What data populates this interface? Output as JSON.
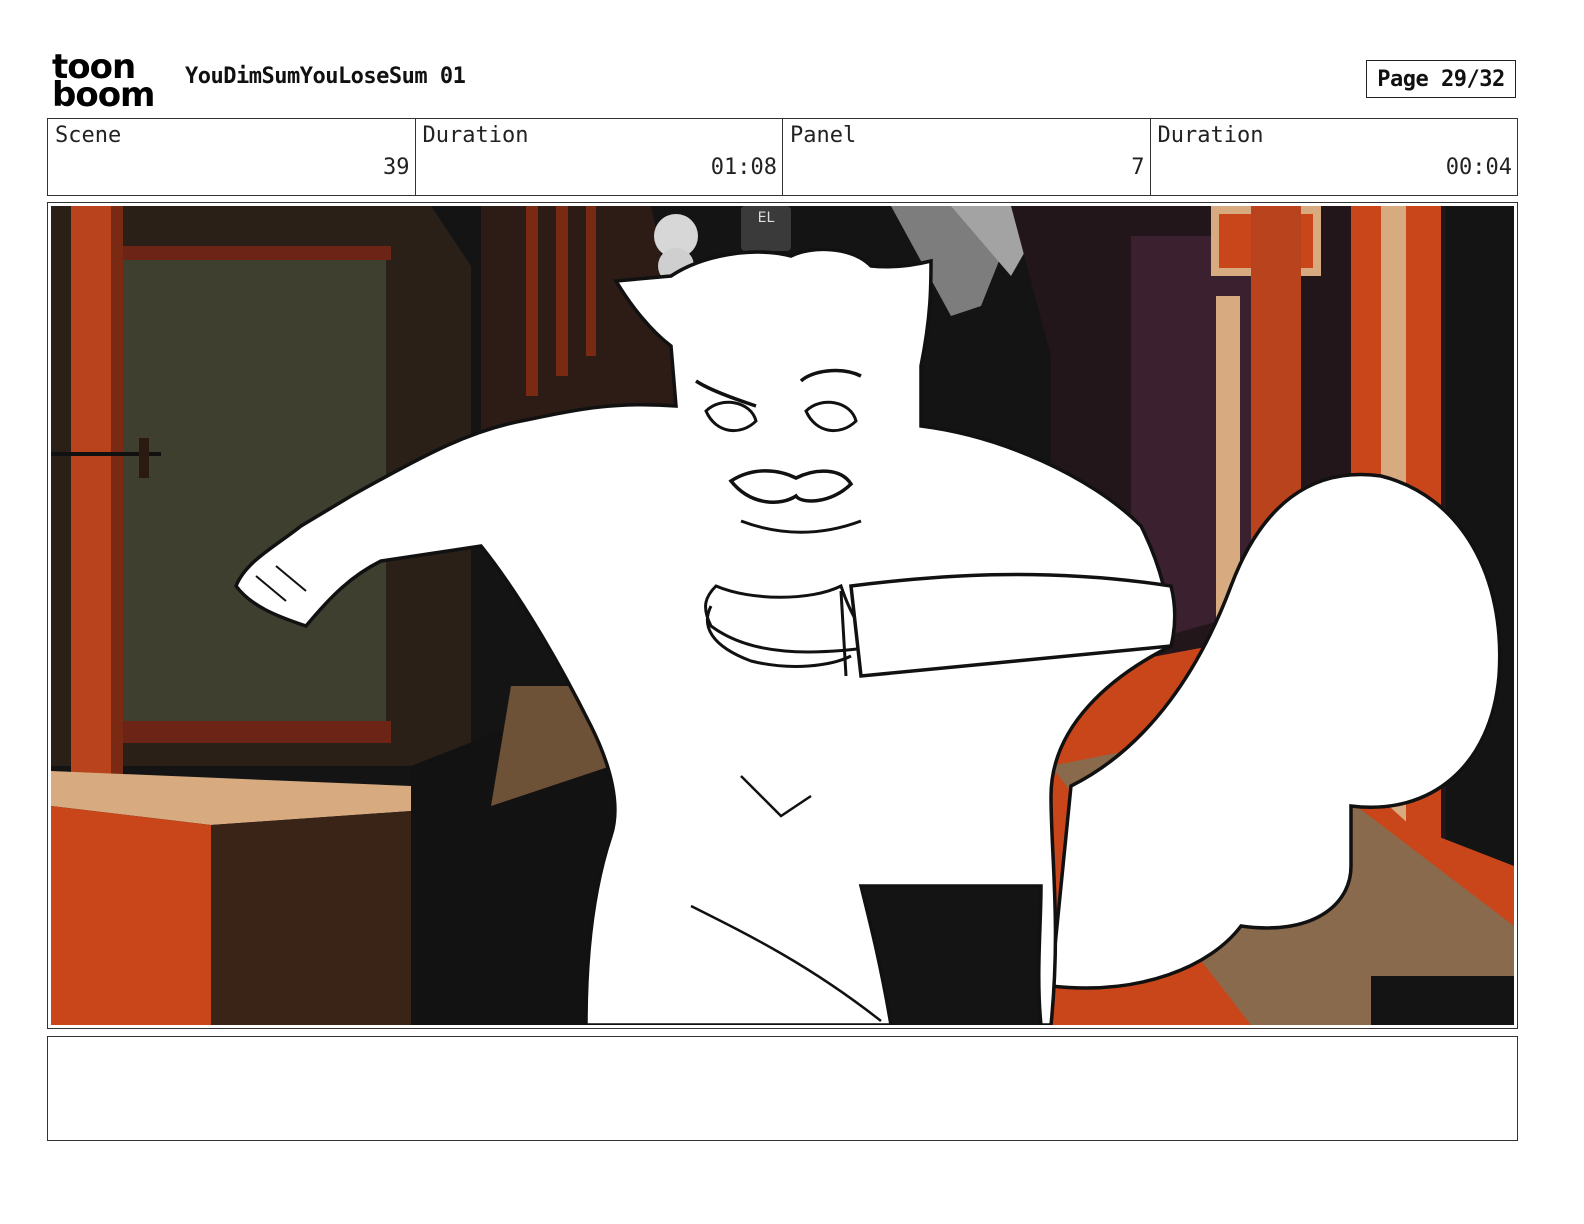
{
  "header": {
    "logo": {
      "line1": "toon",
      "line2": "boom"
    },
    "project_title": "YouDimSumYouLoseSum 01",
    "page_indicator": "Page 29/32"
  },
  "info": {
    "scene": {
      "label": "Scene",
      "value": "39"
    },
    "scene_duration": {
      "label": "Duration",
      "value": "01:08"
    },
    "panel": {
      "label": "Panel",
      "value": "7"
    },
    "panel_duration": {
      "label": "Duration",
      "value": "00:04"
    }
  },
  "panel_image": {
    "sign_letters": "EL"
  },
  "notes": {
    "text": ""
  },
  "colors": {
    "accent_orange": "#c9461a",
    "dark_bg": "#1a1a1a",
    "wall_olive": "#3f3f30",
    "tan_wood": "#d7aa80",
    "purple_wall": "#3b2030",
    "sketch_fill": "#ffffff",
    "sketch_line": "#111111"
  }
}
